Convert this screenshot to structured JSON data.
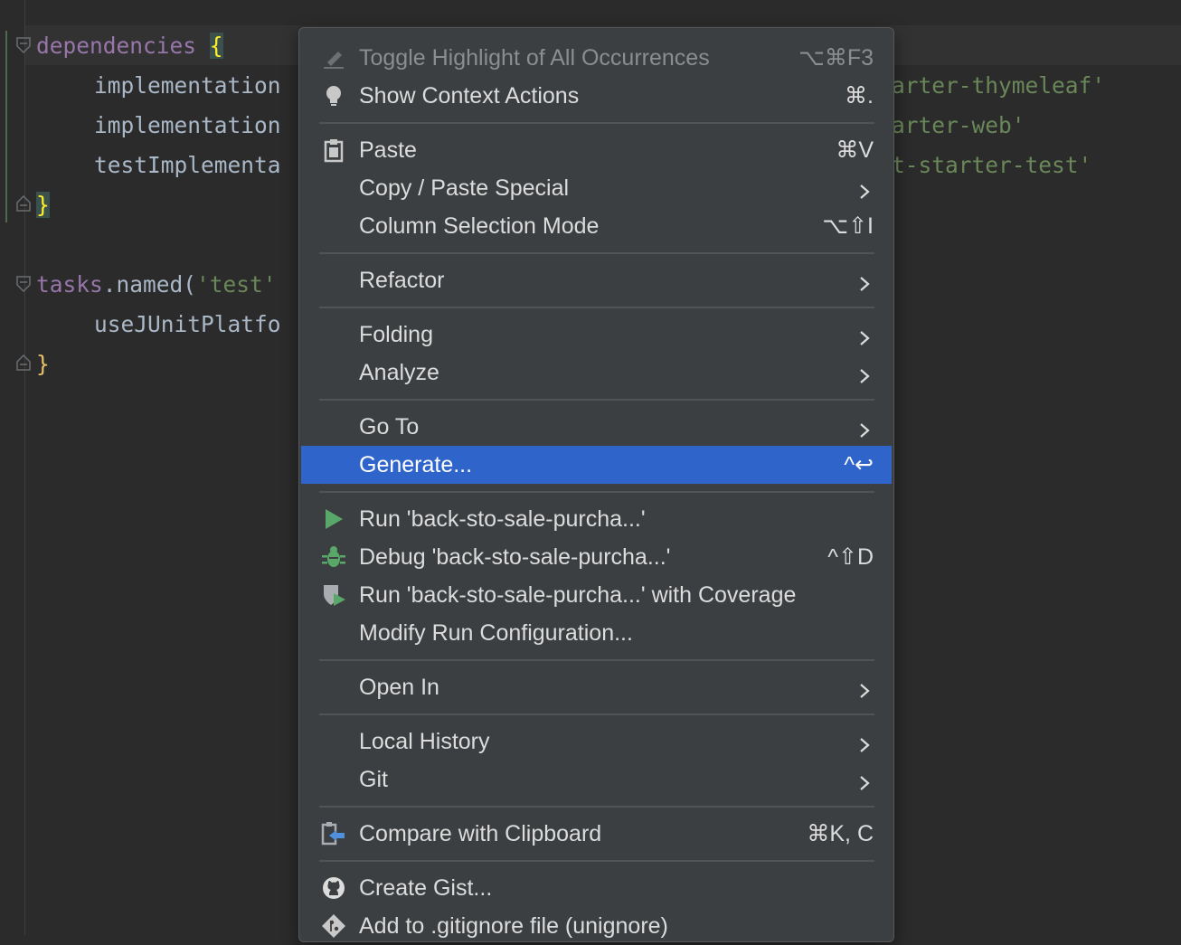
{
  "editor": {
    "lines": [
      {
        "parts": [
          {
            "text": "dependencies",
            "cls": "kw"
          },
          {
            "text": " ",
            "cls": "plain"
          },
          {
            "text": "{",
            "cls": "brace-hl"
          }
        ]
      },
      {
        "parts": [
          {
            "text": "implementation",
            "cls": "plain"
          }
        ]
      },
      {
        "parts": [
          {
            "text": "implementation",
            "cls": "plain"
          }
        ]
      },
      {
        "parts": [
          {
            "text": "testImplementa",
            "cls": "plain"
          }
        ]
      },
      {
        "parts": [
          {
            "text": "}",
            "cls": "brace-hl"
          }
        ]
      },
      {
        "parts": [
          {
            "text": "tasks",
            "cls": "kw"
          },
          {
            "text": ".named(",
            "cls": "plain"
          },
          {
            "text": "'test'",
            "cls": "str"
          }
        ]
      },
      {
        "parts": [
          {
            "text": "useJUnitPlatfo",
            "cls": "plain"
          }
        ]
      },
      {
        "parts": [
          {
            "text": "}",
            "cls": "brace"
          }
        ]
      }
    ],
    "right_fragments": [
      "arter-thymeleaf'",
      "arter-web'",
      "t-starter-test'"
    ]
  },
  "menu": {
    "items": [
      {
        "label": "Toggle Highlight of All Occurrences",
        "shortcut": "⌥⌘F3",
        "icon": "highlight-icon",
        "disabled": true
      },
      {
        "label": "Show Context Actions",
        "shortcut": "⌘.",
        "icon": "bulb-icon"
      },
      {
        "label": "Paste",
        "shortcut": "⌘V",
        "icon": "clipboard-icon"
      },
      {
        "label": "Copy / Paste Special",
        "submenu": true
      },
      {
        "label": "Column Selection Mode",
        "shortcut": "⌥⇧I"
      },
      {
        "label": "Refactor",
        "submenu": true
      },
      {
        "label": "Folding",
        "submenu": true
      },
      {
        "label": "Analyze",
        "submenu": true
      },
      {
        "label": "Go To",
        "submenu": true
      },
      {
        "label": "Generate...",
        "shortcut": "^↩",
        "selected": true
      },
      {
        "label": "Run 'back-sto-sale-purcha...'",
        "icon": "run-icon"
      },
      {
        "label": "Debug 'back-sto-sale-purcha...'",
        "shortcut": "^⇧D",
        "icon": "debug-icon"
      },
      {
        "label": "Run 'back-sto-sale-purcha...' with Coverage",
        "icon": "coverage-icon"
      },
      {
        "label": "Modify Run Configuration..."
      },
      {
        "label": "Open In",
        "submenu": true
      },
      {
        "label": "Local History",
        "submenu": true
      },
      {
        "label": "Git",
        "submenu": true
      },
      {
        "label": "Compare with Clipboard",
        "shortcut": "⌘K, C",
        "icon": "compare-icon"
      },
      {
        "label": "Create Gist...",
        "icon": "github-icon"
      },
      {
        "label": "Add to .gitignore file (unignore)",
        "icon": "gitignore-icon"
      }
    ]
  },
  "colors": {
    "selection": "#2f65ca",
    "run_green": "#59a869",
    "keyword": "#9876aa",
    "string": "#6a8759"
  }
}
